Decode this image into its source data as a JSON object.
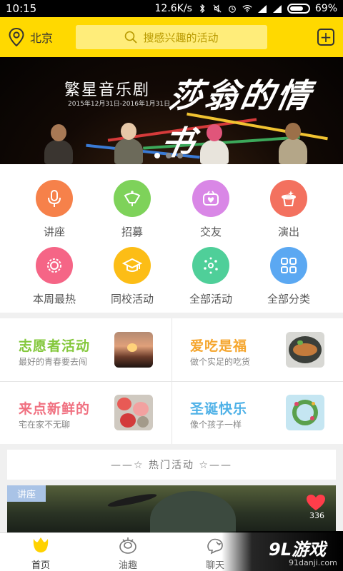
{
  "status_bar": {
    "time": "10:15",
    "net_speed": "12.6K/s",
    "battery": "69%"
  },
  "header": {
    "city": "北京",
    "search_placeholder": "搜感兴趣的活动",
    "add_label": "+"
  },
  "banner": {
    "title": "繁星音乐剧",
    "dates": "2015年12月31日-2016年1月31日",
    "calligraphy": "莎翁的情书",
    "page_dots": 3,
    "active_dot": 0
  },
  "categories": [
    {
      "label": "讲座",
      "icon": "microphone-icon",
      "color": "#f6814a"
    },
    {
      "label": "招募",
      "icon": "megaphone-icon",
      "color": "#7ed25a"
    },
    {
      "label": "交友",
      "icon": "friends-icon",
      "color": "#d987e6"
    },
    {
      "label": "演出",
      "icon": "magic-hat-icon",
      "color": "#f3715f"
    },
    {
      "label": "本周最热",
      "icon": "badge-icon",
      "color": "#f56586"
    },
    {
      "label": "同校活动",
      "icon": "graduation-cap-icon",
      "color": "#fcbd16"
    },
    {
      "label": "全部活动",
      "icon": "sparkles-icon",
      "color": "#4fcf99"
    },
    {
      "label": "全部分类",
      "icon": "grid-icon",
      "color": "#5ba8f2"
    }
  ],
  "promos": [
    {
      "title": "志愿者活动",
      "subtitle": "最好的青春要去闯",
      "color": "#84c83c",
      "image": "sunset-photo"
    },
    {
      "title": "爱吃是福",
      "subtitle": "做个实足的吃货",
      "color": "#f5a52c",
      "image": "fish-dish-photo"
    },
    {
      "title": "来点新鲜的",
      "subtitle": "宅在家不无聊",
      "color": "#f07080",
      "image": "flowers-photo"
    },
    {
      "title": "圣诞快乐",
      "subtitle": "像个孩子一样",
      "color": "#4eb1e7",
      "image": "wreath-photo"
    }
  ],
  "hot_section": {
    "title": "——☆  热门活动  ☆——"
  },
  "feed": [
    {
      "tag": "讲座",
      "likes": "336"
    }
  ],
  "tabs": [
    {
      "label": "首页",
      "icon": "home-icon",
      "active": true
    },
    {
      "label": "油趣",
      "icon": "interest-icon",
      "active": false
    },
    {
      "label": "聊天",
      "icon": "chat-icon",
      "active": false
    }
  ],
  "watermark": {
    "brand": "9L游戏",
    "domain": "91danji.com"
  }
}
